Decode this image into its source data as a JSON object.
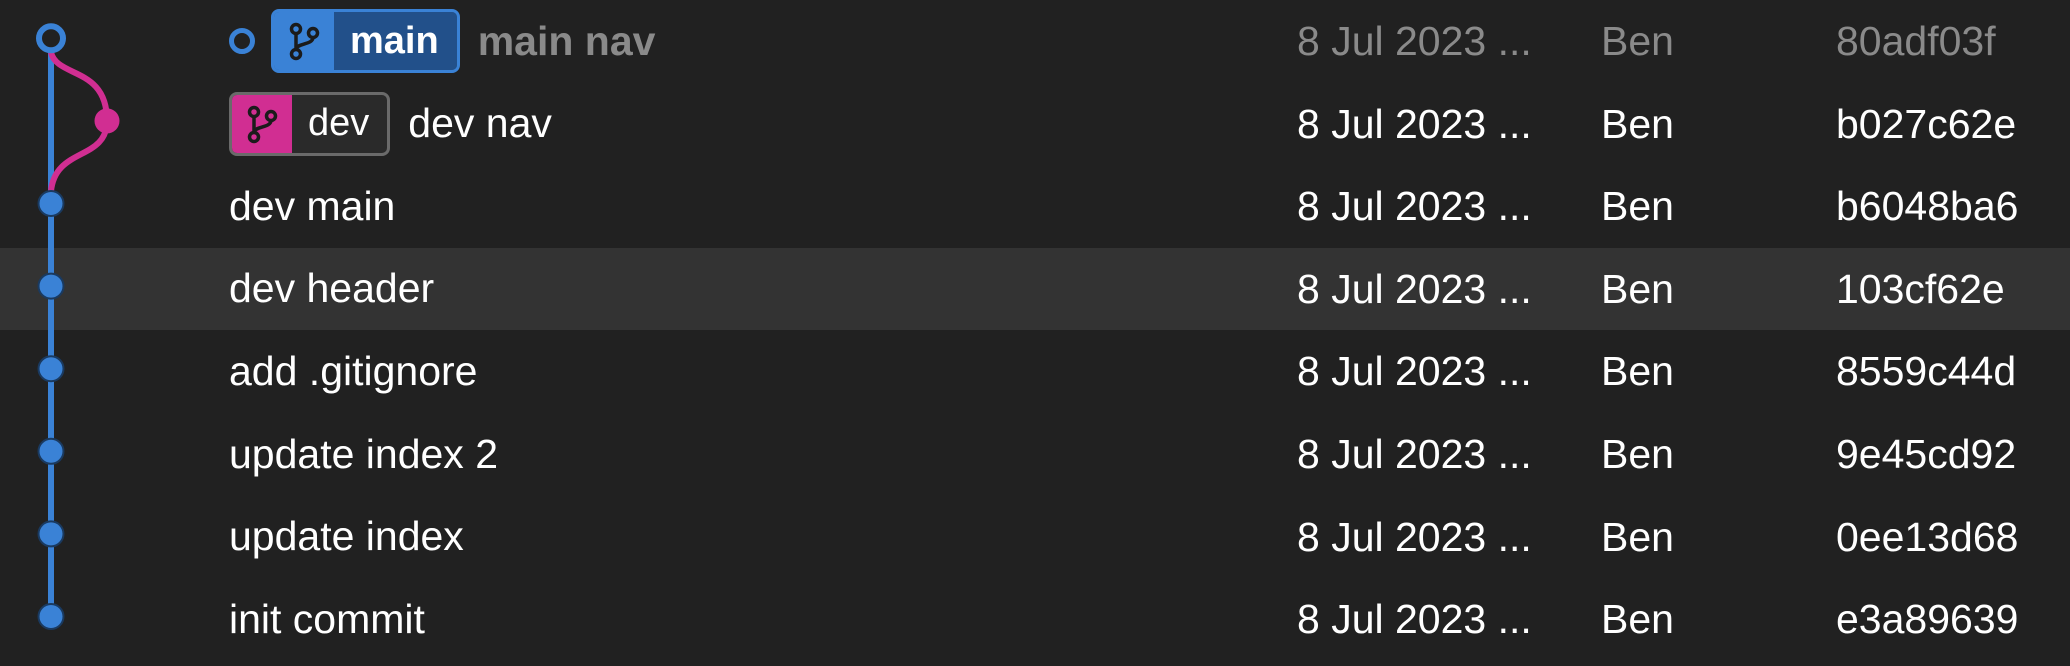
{
  "colors": {
    "main_branch": "#3a82d6",
    "dev_branch": "#d12e92",
    "background": "#212121",
    "selected_row": "#333333"
  },
  "commits": [
    {
      "message": "main nav",
      "date": "8 Jul 2023 ...",
      "author": "Ben",
      "hash": "80adf03f",
      "branch_ref": "main",
      "lane": "main",
      "dimmed": true,
      "head": true
    },
    {
      "message": "dev nav",
      "date": "8 Jul 2023 ...",
      "author": "Ben",
      "hash": "b027c62e",
      "branch_ref": "dev",
      "lane": "dev"
    },
    {
      "message": "dev main",
      "date": "8 Jul 2023 ...",
      "author": "Ben",
      "hash": "b6048ba6",
      "lane": "main"
    },
    {
      "message": "dev header",
      "date": "8 Jul 2023 ...",
      "author": "Ben",
      "hash": "103cf62e",
      "lane": "main",
      "selected": true
    },
    {
      "message": "add .gitignore",
      "date": "8 Jul 2023 ...",
      "author": "Ben",
      "hash": "8559c44d",
      "lane": "main"
    },
    {
      "message": "update index 2",
      "date": "8 Jul 2023 ...",
      "author": "Ben",
      "hash": "9e45cd92",
      "lane": "main"
    },
    {
      "message": "update index",
      "date": "8 Jul 2023 ...",
      "author": "Ben",
      "hash": "0ee13d68",
      "lane": "main"
    },
    {
      "message": "init commit",
      "date": "8 Jul 2023 ...",
      "author": "Ben",
      "hash": "e3a89639",
      "lane": "main"
    }
  ],
  "branch_icon": "git-branch-icon"
}
